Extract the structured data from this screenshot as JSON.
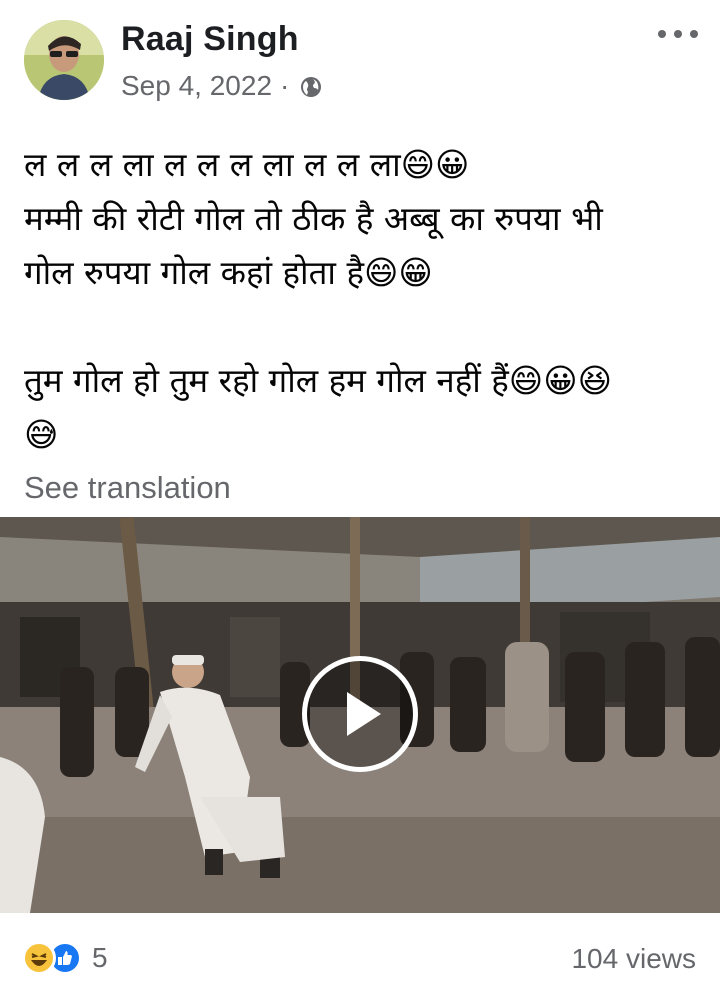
{
  "post": {
    "author": "Raaj Singh",
    "date": "Sep 4, 2022",
    "separator": "·",
    "privacy_icon": "globe-icon",
    "more_icon": "more-horizontal-icon",
    "text_lines": [
      "ल ल ल ला ल ल ल ला ल ल ला😄😀",
      "मम्मी की रोटी गोल  तो ठीक है अब्बू का रुपया भी",
      "गोल रुपया गोल कहां होता है😄😁",
      "",
      "तुम गोल हो तुम रहो गोल हम गोल नहीं हैं😄😀😆",
      "😅"
    ],
    "see_translation": "See translation"
  },
  "video": {
    "play_icon": "play-icon"
  },
  "footer": {
    "reaction_icons": [
      "haha-icon",
      "like-icon"
    ],
    "reaction_count": "5",
    "views": "104 views"
  },
  "colors": {
    "secondary_text": "#65676b",
    "primary_text": "#050505",
    "like_blue": "#1877f2",
    "haha_yellow": "#f7c33c"
  }
}
